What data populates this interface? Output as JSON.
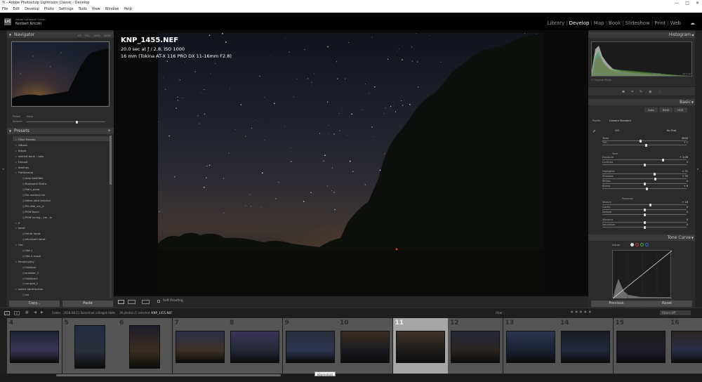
{
  "window": {
    "title": "Yi - Adobe Photoshop Lightroom Classic - Develop",
    "controls": [
      "—",
      "□",
      "✕"
    ]
  },
  "menu": [
    "File",
    "Edit",
    "Develop",
    "Photo",
    "Settings",
    "Tools",
    "View",
    "Window",
    "Help"
  ],
  "identity": {
    "logo": "LrC",
    "app_line": "Adobe Lightroom Classic",
    "user": "Norbert Kriczki"
  },
  "modules": {
    "items": [
      "Library",
      "Develop",
      "Map",
      "Book",
      "Slideshow",
      "Print",
      "Web"
    ],
    "active": "Develop"
  },
  "left_panel": {
    "navigator": {
      "title": "Navigator",
      "zoom": [
        "FIT",
        "FILL",
        "100%",
        "400%"
      ]
    },
    "preset_bar": {
      "preset_label": "Preset",
      "amount_label": "Amount",
      "none_label": "None"
    },
    "presets": {
      "title": "Presets",
      "add": "+",
      "items": [
        {
          "label": "Filter Presets",
          "level": 0
        },
        {
          "label": "ABoser",
          "level": 0
        },
        {
          "label": "Bloser",
          "level": 0
        },
        {
          "label": "esküvő berni - raku",
          "level": 0
        },
        {
          "label": "Eskuvő",
          "level": 0
        },
        {
          "label": "étellhos",
          "level": 0
        },
        {
          "label": "Fiatfakacsa",
          "level": 0
        },
        {
          "label": "alap beállítás",
          "level": 1
        },
        {
          "label": "Budapest Bistro",
          "level": 1
        },
        {
          "label": "Dahl_pizza",
          "level": 1
        },
        {
          "label": "Da mertesi-hal",
          "level": 1
        },
        {
          "label": "kékes kéré kerettel",
          "level": 1
        },
        {
          "label": "RG-08b_vm_lc",
          "level": 1
        },
        {
          "label": "RGB Basel",
          "level": 1
        },
        {
          "label": "RGB tuning - vm - lc",
          "level": 1
        },
        {
          "label": "If",
          "level": 0
        },
        {
          "label": "keret",
          "level": 0
        },
        {
          "label": "Fehér keret",
          "level": 1
        },
        {
          "label": "kéviskoltl keret",
          "level": 1
        },
        {
          "label": "Okt",
          "level": 0
        },
        {
          "label": "Okt-1",
          "level": 1
        },
        {
          "label": "Okt-2-mask",
          "level": 1
        },
        {
          "label": "Pandecsány",
          "level": 0
        },
        {
          "label": "Outdoor",
          "level": 1
        },
        {
          "label": "outdoor_3",
          "level": 1
        },
        {
          "label": "Outdoor2",
          "level": 1
        },
        {
          "label": "sunped_2",
          "level": 1
        },
        {
          "label": "színes kontrasztos",
          "level": 0
        },
        {
          "label": "szi",
          "level": 1
        }
      ]
    },
    "copy_label": "Copy...",
    "paste_label": "Paste"
  },
  "photo_info": {
    "filename": "KNP_1455.NEF",
    "exposure": "20.0 sec at ƒ / 2,8, ISO 1000",
    "lens": "16 mm (Tokina AT-X 116 PRO DX 11-16mm F2.8)"
  },
  "toolbar": {
    "soft_proofing": "Soft Proofing"
  },
  "right_panel": {
    "histogram": {
      "title": "Histogram",
      "readout": [
        "ISO 1000",
        "16 mm",
        "ƒ / 2,8",
        "20.0 sec"
      ],
      "original_photo": "Original Photo"
    },
    "basic": {
      "title": "Basic",
      "treatment": [
        "Auto",
        "B&W",
        "HDR"
      ],
      "profile_label": "Profile:",
      "profile_value": "Camera Standard",
      "wb_label": "WB :",
      "wb_value": "As Shot",
      "sliders": [
        {
          "label": "Temp",
          "value": "4000",
          "pos": 0.45
        },
        {
          "label": "Tint",
          "value": "+ 7",
          "pos": 0.52
        },
        {
          "label": "Exposure",
          "value": "+ 2,06",
          "pos": 0.72
        },
        {
          "label": "Contrast",
          "value": "0",
          "pos": 0.5
        },
        {
          "label": "Highlights",
          "value": "+ 31",
          "pos": 0.62
        },
        {
          "label": "Shadows",
          "value": "+ 33",
          "pos": 0.63
        },
        {
          "label": "Whites",
          "value": "0",
          "pos": 0.5
        },
        {
          "label": "Blacks",
          "value": "+ 9",
          "pos": 0.53
        },
        {
          "label": "Texture",
          "value": "+ 18",
          "pos": 0.57
        },
        {
          "label": "Clarity",
          "value": "0",
          "pos": 0.5
        },
        {
          "label": "Dehaze",
          "value": "0",
          "pos": 0.5
        },
        {
          "label": "Vibrance",
          "value": "0",
          "pos": 0.5
        },
        {
          "label": "Saturation",
          "value": "0",
          "pos": 0.5
        }
      ],
      "tone_label": "Tone",
      "presence_label": "Presence"
    },
    "tone_curve": {
      "title": "Tone Curve",
      "adjust_label": "Adjust"
    },
    "previous_label": "Previous",
    "reset_label": "Reset"
  },
  "filmbar": {
    "pages": [
      "1",
      "2"
    ],
    "path": "Folder : 2018-08-11 Szandrval csillagok ekék",
    "count": "39 photos /1 selected /",
    "selected_file": "KNP_1455.NEF",
    "filter_label": "Filter :",
    "filters_off": "Filters Off"
  },
  "filmstrip": {
    "cells": [
      {
        "num": "4",
        "selected": false
      },
      {
        "num": "5",
        "selected": false
      },
      {
        "num": "6",
        "selected": false
      },
      {
        "num": "7",
        "selected": false
      },
      {
        "num": "8",
        "selected": false
      },
      {
        "num": "9",
        "selected": false
      },
      {
        "num": "10",
        "selected": false
      },
      {
        "num": "11",
        "selected": true
      },
      {
        "num": "12",
        "selected": false
      },
      {
        "num": "13",
        "selected": false
      },
      {
        "num": "14",
        "selected": false
      },
      {
        "num": "15",
        "selected": false
      },
      {
        "num": "16",
        "selected": false
      }
    ],
    "tooltip": "Képmetsző"
  }
}
